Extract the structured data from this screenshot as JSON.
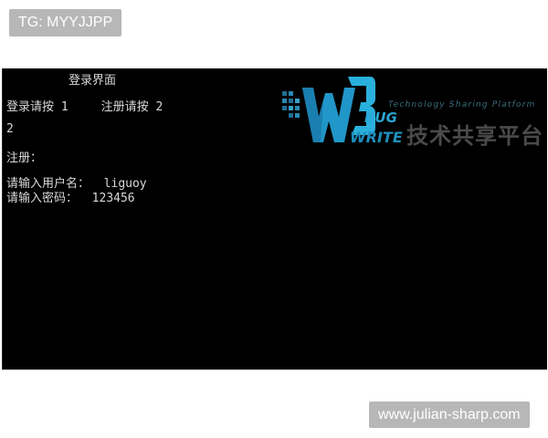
{
  "badges": {
    "top": "TG: MYYJJPP",
    "bottom": "www.julian-sharp.com"
  },
  "console": {
    "title": "登录界面",
    "menu_login": "登录请按 1",
    "menu_register": "注册请按 2",
    "input_value": "2",
    "register_label": "注册：",
    "username_prompt": "请输入用户名：",
    "username_value": "liguoy",
    "password_prompt": "请输入密码：",
    "password_value": "123456"
  },
  "watermark": {
    "tagline": "Technology Sharing Platform",
    "bug": "BUG",
    "write": "WRITE",
    "chinese": "技术共享平台"
  },
  "colors": {
    "console_bg": "#000000",
    "console_text": "#d9d9d9",
    "badge_bg": "#b7b7b7",
    "logo_blue": "#2aa7d6"
  }
}
